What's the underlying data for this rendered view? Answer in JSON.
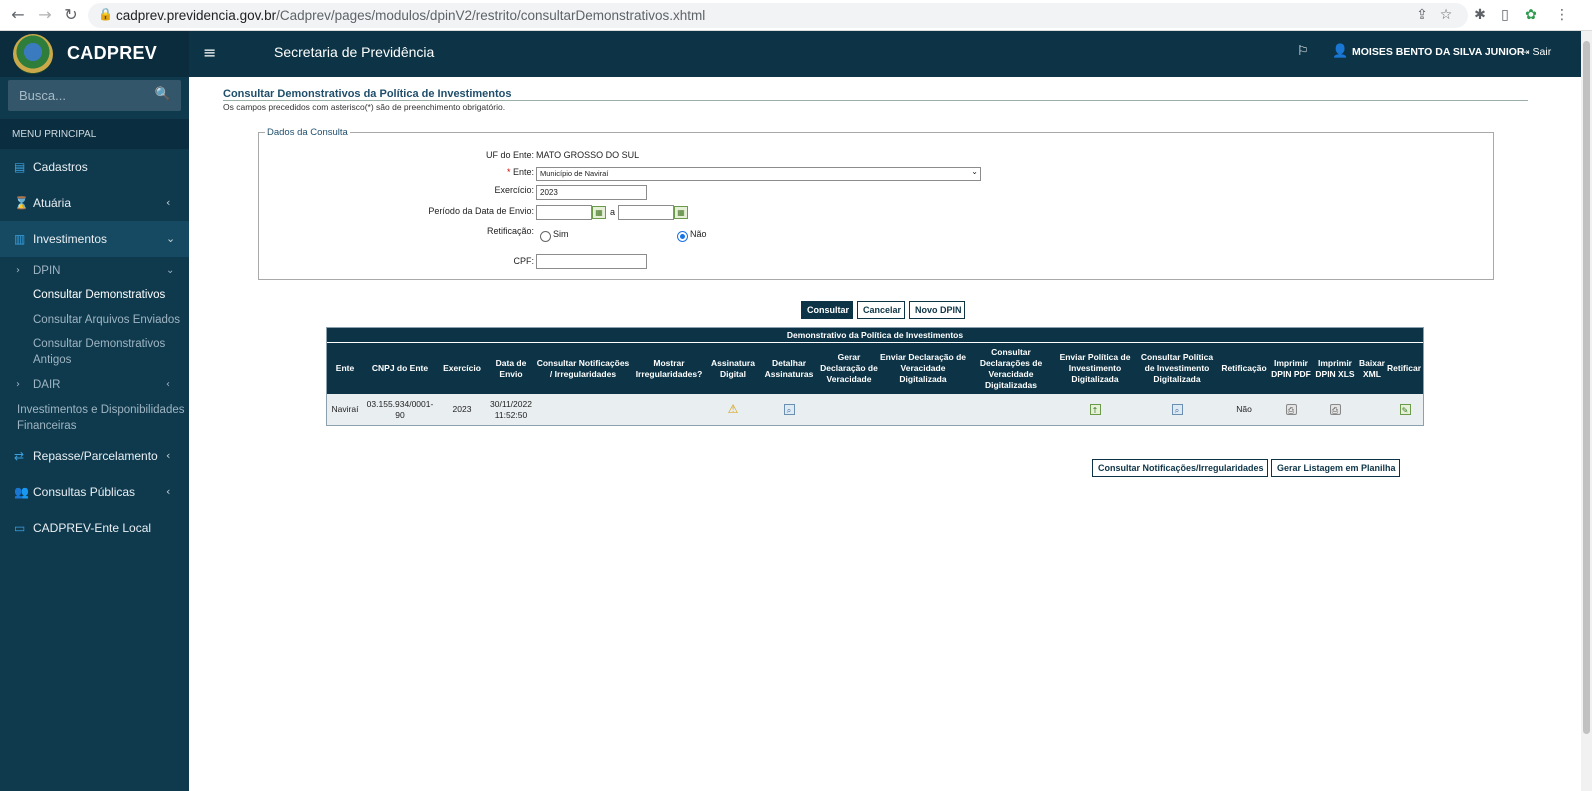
{
  "browser": {
    "url_host": "cadprev.previdencia.gov.br",
    "url_path": "/Cadprev/pages/modulos/dpinV2/restrito/consultarDemonstrativos.xhtml"
  },
  "header": {
    "brand": "CADPREV",
    "section": "Secretaria de Previdência",
    "user_name": "MOISES BENTO DA SILVA JUNIOR",
    "logout": "Sair"
  },
  "sidebar": {
    "search_placeholder": "Busca...",
    "menu_header": "MENU PRINCIPAL",
    "items": [
      {
        "label": "Cadastros"
      },
      {
        "label": "Atuária"
      },
      {
        "label": "Investimentos"
      },
      {
        "label": "DPIN"
      },
      {
        "label": "Consultar Demonstrativos"
      },
      {
        "label": "Consultar Arquivos Enviados"
      },
      {
        "label": "Consultar Demonstrativos Antigos"
      },
      {
        "label": "DAIR"
      },
      {
        "label": "Investimentos e Disponibilidades Financeiras"
      },
      {
        "label": "Repasse/Parcelamento"
      },
      {
        "label": "Consultas Públicas"
      },
      {
        "label": "CADPREV-Ente Local"
      }
    ]
  },
  "page": {
    "title": "Consultar Demonstrativos da Política de Investimentos",
    "note": "Os campos precedidos com asterisco(*) são de preenchimento obrigatório."
  },
  "form": {
    "legend": "Dados da Consulta",
    "uf_label": "UF do Ente:",
    "uf_value": "MATO GROSSO DO SUL",
    "ente_required": "*",
    "ente_label": "Ente:",
    "ente_value": "Município de Naviraí",
    "exercicio_label": "Exercício:",
    "exercicio_value": "2023",
    "periodo_label": "Período da Data de Envio:",
    "periodo_sep": "a",
    "retificacao_label": "Retificação:",
    "ret_sim": "Sim",
    "ret_nao": "Não",
    "cpf_label": "CPF:"
  },
  "actions": {
    "consultar": "Consultar",
    "cancelar": "Cancelar",
    "novo": "Novo DPIN"
  },
  "table": {
    "caption": "Demonstrativo da Política de Investimentos",
    "headers": [
      "Ente",
      "CNPJ do Ente",
      "Exercício",
      "Data de Envio",
      "Consultar Notificações / Irregularidades",
      "Mostrar Irregularidades?",
      "Assinatura Digital",
      "Detalhar Assinaturas",
      "Gerar Declaração de Veracidade",
      "Enviar Declaração de Veracidade Digitalizada",
      "Consultar Declarações de Veracidade Digitalizadas",
      "Enviar Política de Investimento Digitalizada",
      "Consultar Política de Investimento Digitalizada",
      "Retificação",
      "Imprimir DPIN PDF",
      "Imprimir DPIN XLS",
      "Baixar XML",
      "Retificar"
    ],
    "row": {
      "ente": "Naviraí",
      "cnpj": "03.155.934/0001-90",
      "exercicio": "2023",
      "data_envio": "30/11/2022 11:52:50",
      "retificacao": "Não"
    }
  },
  "bottom_actions": {
    "notificacoes": "Consultar Notificações/Irregularidades",
    "planilha": "Gerar Listagem em Planilha"
  }
}
